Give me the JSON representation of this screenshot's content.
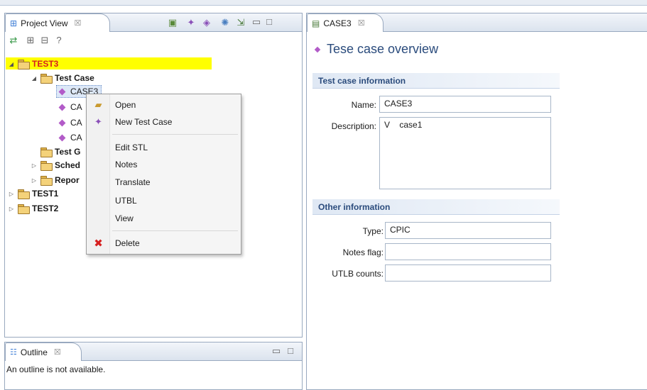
{
  "project_view": {
    "tab_label": "Project View",
    "tab_close": "☒",
    "tree": {
      "root": "TEST3",
      "test_case_folder": "Test Case",
      "cases": [
        "CASE3",
        "CA",
        "CA",
        "CA"
      ],
      "test_group": "Test G",
      "schedule": "Sched",
      "report": "Repor",
      "test1": "TEST1",
      "test2": "TEST2"
    }
  },
  "context_menu": {
    "open": "Open",
    "new_test_case": "New Test Case",
    "edit_stl": "Edit STL",
    "notes": "Notes",
    "translate": "Translate",
    "utbl": "UTBL",
    "view": "View",
    "delete": "Delete"
  },
  "outline": {
    "tab_label": "Outline",
    "tab_close": "☒",
    "message": "An outline is not available."
  },
  "editor": {
    "tab_label": "CASE3",
    "tab_close": "☒",
    "overview_title": "Tese case overview",
    "test_case_info": {
      "header": "Test case information",
      "name_label": "Name:",
      "name_value": "CASE3",
      "description_label": "Description:",
      "description_value": "V    case1"
    },
    "other_info": {
      "header": "Other information",
      "type_label": "Type:",
      "type_value": "CPIC",
      "notes_flag_label": "Notes flag:",
      "notes_flag_value": "",
      "utlb_counts_label": "UTLB counts:",
      "utlb_counts_value": ""
    }
  },
  "colors": {
    "highlight_root": "#ffff00",
    "root_text": "#d62020",
    "accent": "#2a4b7c"
  }
}
